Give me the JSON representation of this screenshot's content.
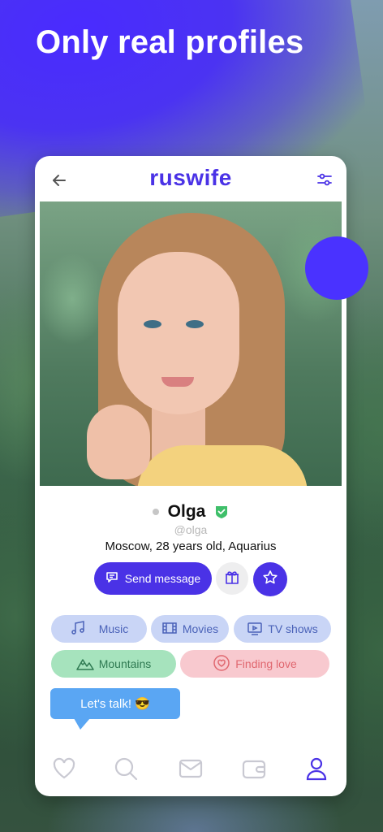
{
  "headline": "Only real profiles",
  "app": {
    "logo_text": "ruswife"
  },
  "profile": {
    "name": "Olga",
    "username": "@olga",
    "details": "Moscow, 28 years old, Aquarius",
    "online_status": "offline"
  },
  "actions": {
    "send_message_label": "Send message"
  },
  "interests": [
    {
      "label": "Music",
      "icon": "music-note-icon"
    },
    {
      "label": "Movies",
      "icon": "film-icon"
    },
    {
      "label": "TV shows",
      "icon": "tv-icon"
    },
    {
      "label": "Mountains",
      "icon": "mountains-icon"
    },
    {
      "label": "Finding love",
      "icon": "heart-icon"
    }
  ],
  "bubble": {
    "text": "Let's talk! 😎"
  },
  "bottom_nav": [
    {
      "label": "likes",
      "icon": "heart-icon"
    },
    {
      "label": "search",
      "icon": "search-icon"
    },
    {
      "label": "messages",
      "icon": "mail-icon"
    },
    {
      "label": "wallet",
      "icon": "wallet-icon"
    },
    {
      "label": "profile",
      "icon": "user-icon",
      "active": true
    }
  ],
  "colors": {
    "brand": "#4a32e6",
    "tag_blue": "#c9d5f6",
    "tag_green": "#a6e3bd",
    "tag_pink": "#f8c9cf",
    "bubble": "#5aa6f3",
    "verified": "#3fbf6a"
  }
}
